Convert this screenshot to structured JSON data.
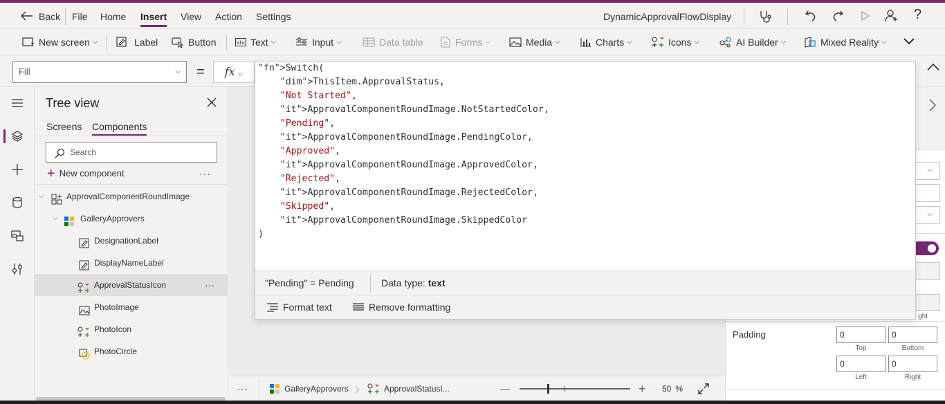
{
  "menu": {
    "back": "Back",
    "items": [
      "File",
      "Home",
      "Insert",
      "View",
      "Action",
      "Settings"
    ],
    "app_name": "DynamicApprovalFlowDisplay"
  },
  "toolbar": {
    "new_screen": "New screen",
    "label": "Label",
    "button": "Button",
    "text": "Text",
    "input": "Input",
    "data_table": "Data table",
    "forms": "Forms",
    "media": "Media",
    "charts": "Charts",
    "icons": "Icons",
    "ai_builder": "AI Builder",
    "mixed_reality": "Mixed Reality"
  },
  "formula_bar": {
    "property": "Fill",
    "equals": "=",
    "fx": "fx"
  },
  "formula": {
    "lines": [
      "Switch(",
      "    ThisItem.ApprovalStatus,",
      "    \"Not Started\",",
      "    ApprovalComponentRoundImage.NotStartedColor,",
      "    \"Pending\",",
      "    ApprovalComponentRoundImage.PendingColor,",
      "    \"Approved\",",
      "    ApprovalComponentRoundImage.ApprovedColor,",
      "    \"Rejected\",",
      "    ApprovalComponentRoundImage.RejectedColor,",
      "    \"Skipped\",",
      "    ApprovalComponentRoundImage.SkippedColor",
      ")"
    ],
    "result_expr": "\"Pending\"  =  Pending",
    "data_type_label": "Data type:",
    "data_type_value": "text",
    "format_text": "Format text",
    "remove_formatting": "Remove formatting"
  },
  "tree_view": {
    "title": "Tree view",
    "tabs": [
      "Screens",
      "Components"
    ],
    "active_tab": "Components",
    "search_placeholder": "Search",
    "new_component": "New component",
    "dots": "···",
    "items": [
      {
        "label": "ApprovalComponentRoundImage",
        "icon": "component-icon",
        "level": 0
      },
      {
        "label": "GalleryApprovers",
        "icon": "gallery-icon",
        "level": 1
      },
      {
        "label": "DesignationLabel",
        "icon": "label-icon",
        "level": 2
      },
      {
        "label": "DisplayNameLabel",
        "icon": "label-icon",
        "level": 2
      },
      {
        "label": "ApprovalStatusIcon",
        "icon": "icons-icon",
        "level": 2,
        "selected": true
      },
      {
        "label": "PhotoImage",
        "icon": "image-icon",
        "level": 2
      },
      {
        "label": "PhotoIcon",
        "icon": "icons-icon",
        "level": 2
      },
      {
        "label": "PhotoCircle",
        "icon": "shape-icon",
        "level": 2
      }
    ]
  },
  "properties": {
    "padding_label": "Padding",
    "padding": {
      "top": "0",
      "bottom": "0",
      "left": "0",
      "right": "0"
    },
    "captions": {
      "top": "Top",
      "bottom": "Bottom",
      "left": "Left",
      "right": "Right"
    },
    "truncated_caption": "ght"
  },
  "bottom_bar": {
    "more": "···",
    "crumb1": "GalleryApprovers",
    "crumb2": "ApprovalStatusI...",
    "minus": "—",
    "plus": "+",
    "zoom": "50",
    "zoom_unit": "%"
  },
  "colors": {
    "accent": "#742774",
    "string": "#a31515",
    "keyword": "#0451a5"
  }
}
